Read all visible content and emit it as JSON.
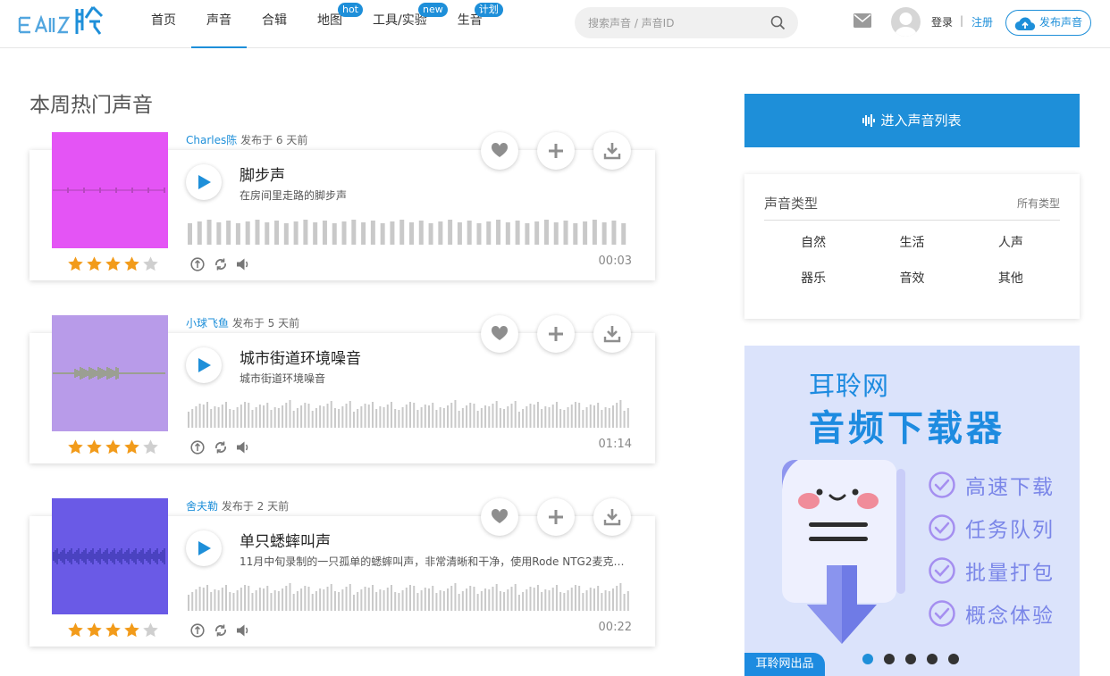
{
  "header": {
    "logo_text": "EAR聆",
    "nav": [
      {
        "label": "首页",
        "badge": ""
      },
      {
        "label": "声音",
        "badge": "",
        "active": true
      },
      {
        "label": "合辑",
        "badge": ""
      },
      {
        "label": "地图",
        "badge": "hot"
      },
      {
        "label": "工具/实验",
        "badge": "new"
      },
      {
        "label": "生音",
        "badge": "计划"
      }
    ],
    "search_placeholder": "搜索声音 / 声音ID",
    "login": "登录",
    "separator": "|",
    "register": "注册",
    "publish": "发布声音"
  },
  "main": {
    "section_title": "本周热门声音",
    "sounds": [
      {
        "author": "Charles陈",
        "published": "发布于 6 天前",
        "title": "脚步声",
        "desc": "在房间里走路的脚步声",
        "duration": "00:03",
        "rating": 4,
        "thumb_color": "#e454f5",
        "wave_color": "#8a3a8a"
      },
      {
        "author": "小球飞鱼",
        "published": "发布于 5 天前",
        "title": "城市街道环境噪音",
        "desc": "城市街道环境噪音",
        "duration": "01:14",
        "rating": 4,
        "thumb_color": "#b89be9",
        "wave_color": "#7ea33c"
      },
      {
        "author": "舍夫勒",
        "published": "发布于 2 天前",
        "title": "单只蟋蟀叫声",
        "desc": "11月中旬录制的一只孤单的蟋蟀叫声，非常清晰和干净，使用Rode NTG2麦克…",
        "duration": "00:22",
        "rating": 4,
        "thumb_color": "#6a5ae6",
        "wave_color": "#2a2a9a"
      }
    ]
  },
  "sidebar": {
    "enter_list": "进入声音列表",
    "types_title": "声音类型",
    "types_all": "所有类型",
    "types": [
      "自然",
      "生活",
      "人声",
      "器乐",
      "音效",
      "其他"
    ],
    "ad": {
      "line1": "耳聆网",
      "line2": "音频下载器",
      "features": [
        "高速下载",
        "任务队列",
        "批量打包",
        "概念体验"
      ],
      "footer": "耳聆网出品",
      "active_slide": 1,
      "slide_count": 5
    }
  },
  "colors": {
    "accent": "#1e8fd9",
    "star": "#f29b1a",
    "star_empty": "#cfcfcf"
  }
}
